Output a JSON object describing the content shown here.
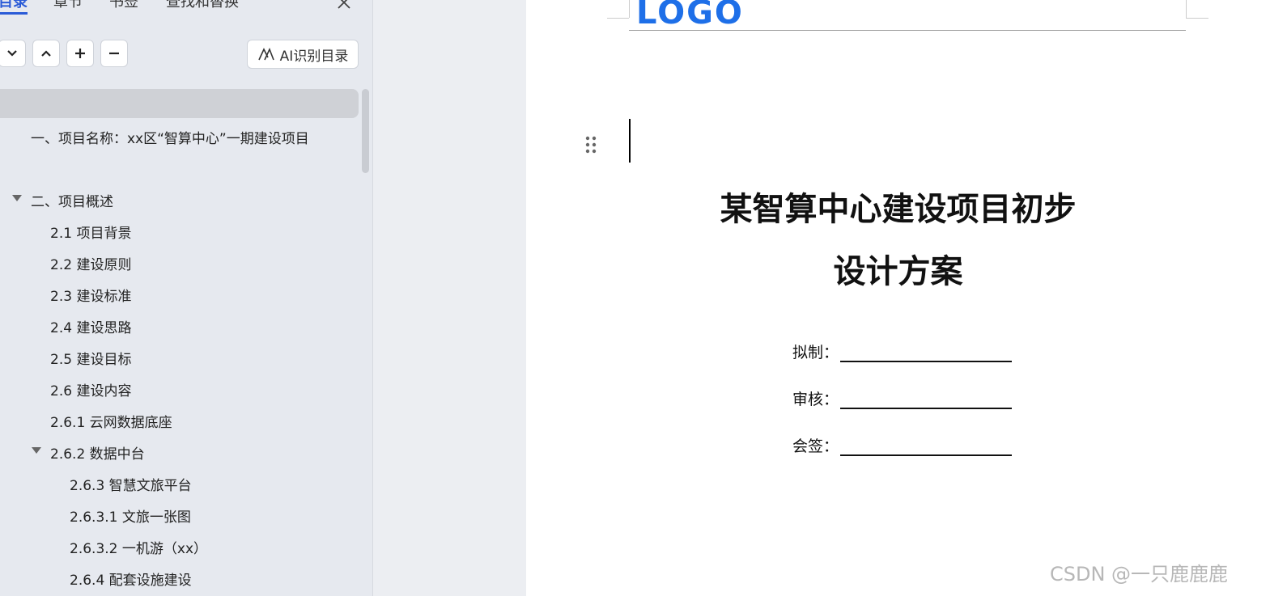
{
  "nav": {
    "tabs": [
      "目录",
      "章节",
      "书签",
      "查找和替换"
    ],
    "ai_button_label": "AI识别目录",
    "toc": [
      {
        "label": "一、项目名称：xx区“智算中心”一期建设项目"
      },
      {
        "label": "二、项目概述"
      },
      {
        "label": "2.1 项目背景"
      },
      {
        "label": "2.2 建设原则"
      },
      {
        "label": "2.3 建设标准"
      },
      {
        "label": "2.4 建设思路"
      },
      {
        "label": "2.5 建设目标"
      },
      {
        "label": "2.6 建设内容"
      },
      {
        "label": "2.6.1 云网数据底座"
      },
      {
        "label": "2.6.2 数据中台"
      },
      {
        "label": "2.6.3 智慧文旅平台"
      },
      {
        "label": "2.6.3.1 文旅一张图"
      },
      {
        "label": "2.6.3.2 一机游（xx）"
      },
      {
        "label": "2.6.4 配套设施建设"
      }
    ]
  },
  "doc": {
    "logo_text": "LOGO",
    "title_line1": "某智算中心建设项目初步",
    "title_line2": "设计方案",
    "sign_rows": [
      "拟制：",
      "审核：",
      "会签："
    ]
  },
  "watermark": "CSDN @一只鹿鹿鹿",
  "colors": {
    "accent": "#2a5bd7",
    "logo": "#1e6fe8"
  }
}
